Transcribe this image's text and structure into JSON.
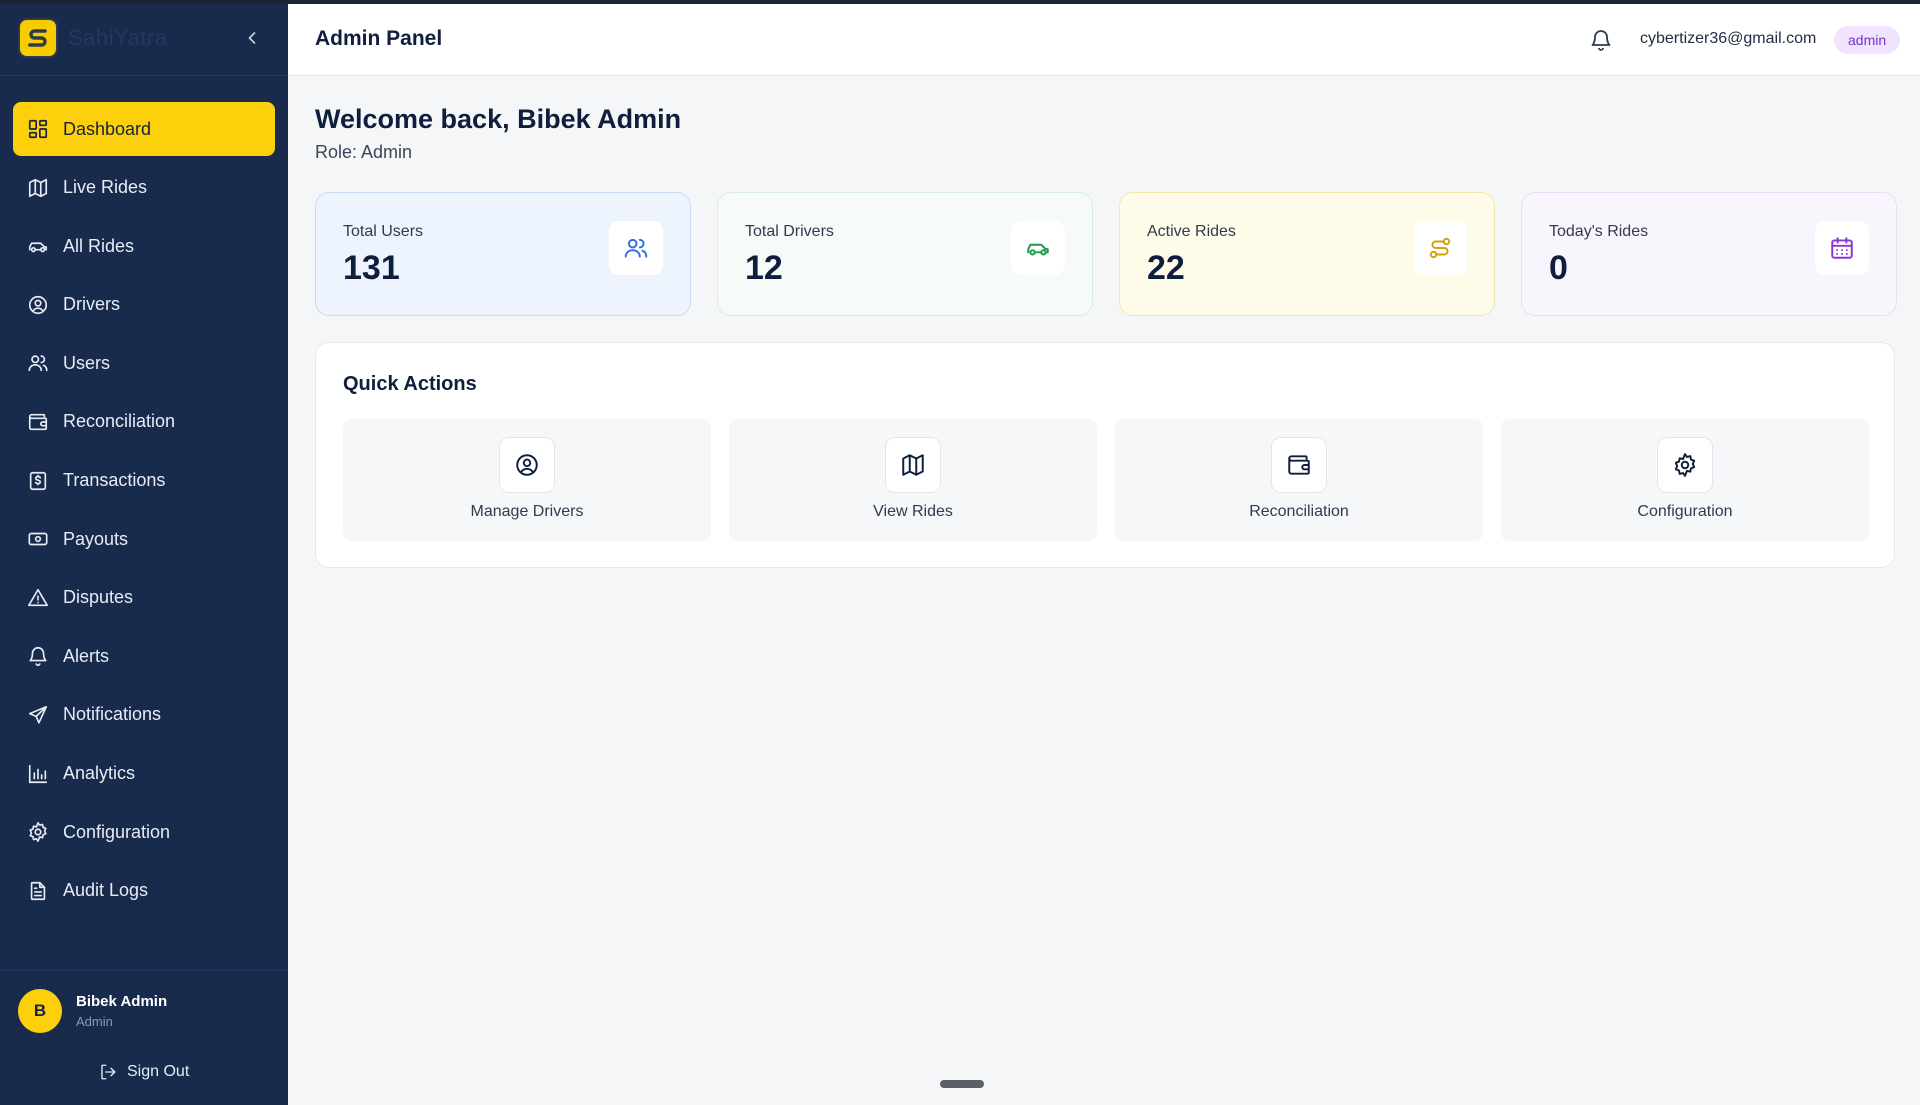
{
  "brand": {
    "name": "SahiYatra"
  },
  "header": {
    "title": "Admin Panel",
    "email": "cybertizer36@gmail.com",
    "role_badge": "admin"
  },
  "sidebar": {
    "items": [
      {
        "label": "Dashboard",
        "icon": "dashboard-icon",
        "active": true
      },
      {
        "label": "Live Rides",
        "icon": "map-icon"
      },
      {
        "label": "All Rides",
        "icon": "car-icon"
      },
      {
        "label": "Drivers",
        "icon": "user-circle-icon"
      },
      {
        "label": "Users",
        "icon": "users-icon"
      },
      {
        "label": "Reconciliation",
        "icon": "wallet-icon"
      },
      {
        "label": "Transactions",
        "icon": "receipt-icon"
      },
      {
        "label": "Payouts",
        "icon": "banknote-icon"
      },
      {
        "label": "Disputes",
        "icon": "alert-triangle-icon"
      },
      {
        "label": "Alerts",
        "icon": "bell-icon"
      },
      {
        "label": "Notifications",
        "icon": "send-icon"
      },
      {
        "label": "Analytics",
        "icon": "bar-chart-icon"
      },
      {
        "label": "Configuration",
        "icon": "gear-icon"
      },
      {
        "label": "Audit Logs",
        "icon": "file-text-icon"
      }
    ],
    "user": {
      "initial": "B",
      "name": "Bibek Admin",
      "role": "Admin"
    },
    "sign_out": "Sign Out"
  },
  "main": {
    "welcome": "Welcome back, Bibek Admin",
    "role_line": "Role: Admin",
    "stats": [
      {
        "label": "Total Users",
        "value": "131",
        "icon": "users-icon",
        "color": "#2f6fe0"
      },
      {
        "label": "Total Drivers",
        "value": "12",
        "icon": "car-icon",
        "color": "#1f9a4a"
      },
      {
        "label": "Active Rides",
        "value": "22",
        "icon": "route-icon",
        "color": "#d1a10a"
      },
      {
        "label": "Today's Rides",
        "value": "0",
        "icon": "calendar-icon",
        "color": "#8b35d6"
      }
    ],
    "quick_actions": {
      "title": "Quick Actions",
      "items": [
        {
          "label": "Manage Drivers",
          "icon": "user-circle-icon"
        },
        {
          "label": "View Rides",
          "icon": "map-icon"
        },
        {
          "label": "Reconciliation",
          "icon": "wallet-icon"
        },
        {
          "label": "Configuration",
          "icon": "gear-icon"
        }
      ]
    }
  },
  "colors": {
    "sidebar_bg": "#182b4d",
    "accent": "#fcd10b",
    "page_bg": "#f5f6f8"
  }
}
